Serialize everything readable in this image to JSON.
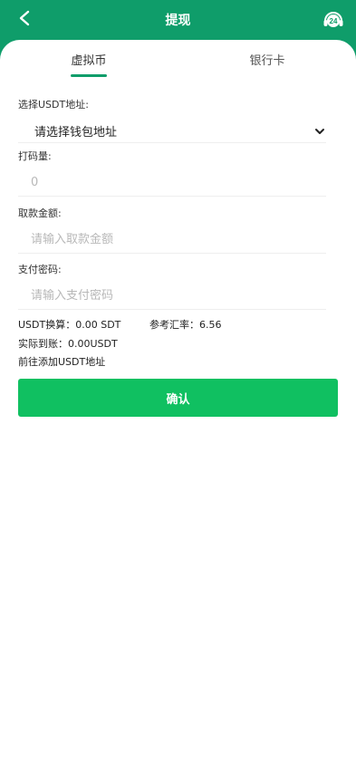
{
  "header": {
    "title": "提现",
    "support_badge": "24",
    "back_icon": "chevron-left-icon",
    "support_icon": "headset-24-icon",
    "accent_color": "#0f9d6a"
  },
  "tabs": [
    {
      "label": "虚拟币",
      "active": true
    },
    {
      "label": "银行卡",
      "active": false
    }
  ],
  "form": {
    "usdt_address_label": "选择USDT地址:",
    "usdt_address_value": "请选择钱包地址",
    "wager_label": "打码量:",
    "wager_value": "0",
    "amount_label": "取款金额:",
    "amount_placeholder": "请输入取款金额",
    "password_label": "支付密码:",
    "password_placeholder": "请输入支付密码"
  },
  "info": {
    "usdt_conversion": "USDT换算：0.00 SDT",
    "exchange_rate": "参考汇率：6.56",
    "actual_received": "实际到账：0.00USDT",
    "add_usdt_link": "前往添加USDT地址"
  },
  "actions": {
    "confirm_label": "确认",
    "confirm_color": "#10c061"
  }
}
